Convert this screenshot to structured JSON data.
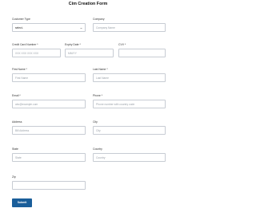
{
  "form": {
    "title": "Cim Creation Form",
    "customer_type": {
      "label": "Customer Type",
      "value": "select-"
    },
    "company": {
      "label": "Company",
      "placeholder": "Company Name"
    },
    "credit_card": {
      "label": "Credit Card Number *",
      "placeholder": "XXX XXX XXX XXX"
    },
    "expiry": {
      "label": "Expiry Date *",
      "placeholder": "MM/YY"
    },
    "cvv": {
      "label": "CVV *",
      "placeholder": ""
    },
    "first_name": {
      "label": "First Name *",
      "placeholder": "First Name"
    },
    "last_name": {
      "label": "Last Name *",
      "placeholder": "Last Name"
    },
    "email": {
      "label": "Email *",
      "placeholder": "abc@example.com"
    },
    "phone": {
      "label": "Phone *",
      "placeholder": "Phone number with country code"
    },
    "address": {
      "label": "Address",
      "placeholder": "Bill Address"
    },
    "city": {
      "label": "City",
      "placeholder": "City"
    },
    "state": {
      "label": "State",
      "placeholder": "State"
    },
    "country": {
      "label": "Country",
      "placeholder": "Country"
    },
    "zip": {
      "label": "Zip",
      "placeholder": ""
    },
    "submit_label": "Submit"
  }
}
